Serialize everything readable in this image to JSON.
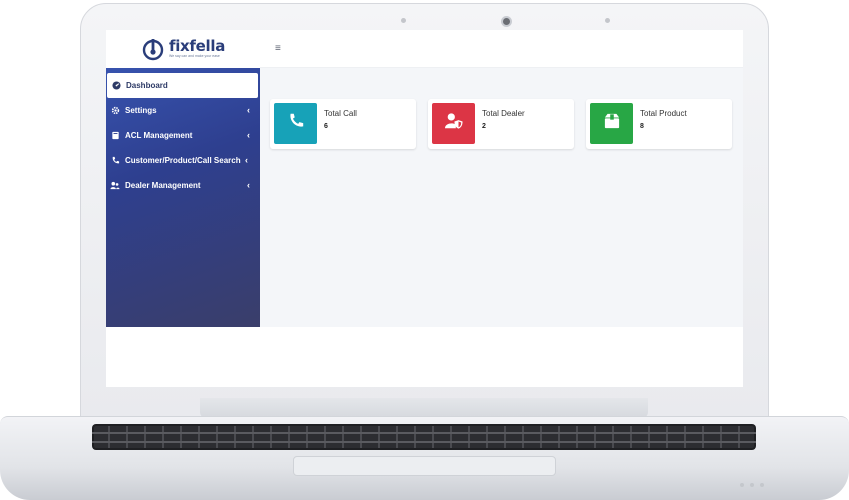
{
  "brand": {
    "name": "fixfella",
    "tagline": "We say can and make your ease"
  },
  "sidebar": {
    "items": [
      {
        "label": "Dashboard",
        "icon": "dashboard-icon",
        "active": true
      },
      {
        "label": "Settings",
        "icon": "gear-icon",
        "has_submenu": true
      },
      {
        "label": "ACL Management",
        "icon": "book-icon",
        "has_submenu": true
      },
      {
        "label": "Customer/Product/Call Search",
        "icon": "phone-icon",
        "has_submenu": true
      },
      {
        "label": "Dealer Management",
        "icon": "users-icon",
        "has_submenu": true
      }
    ],
    "chevron": "‹"
  },
  "topbar": {
    "menu_icon": "≡"
  },
  "cards": [
    {
      "title": "Total Call",
      "value": "6",
      "color": "#17a2b8",
      "icon": "phone-icon"
    },
    {
      "title": "Total Dealer",
      "value": "2",
      "color": "#dc3545",
      "icon": "user-shield-icon"
    },
    {
      "title": "Total Product",
      "value": "8",
      "color": "#28a745",
      "icon": "box-icon"
    }
  ]
}
